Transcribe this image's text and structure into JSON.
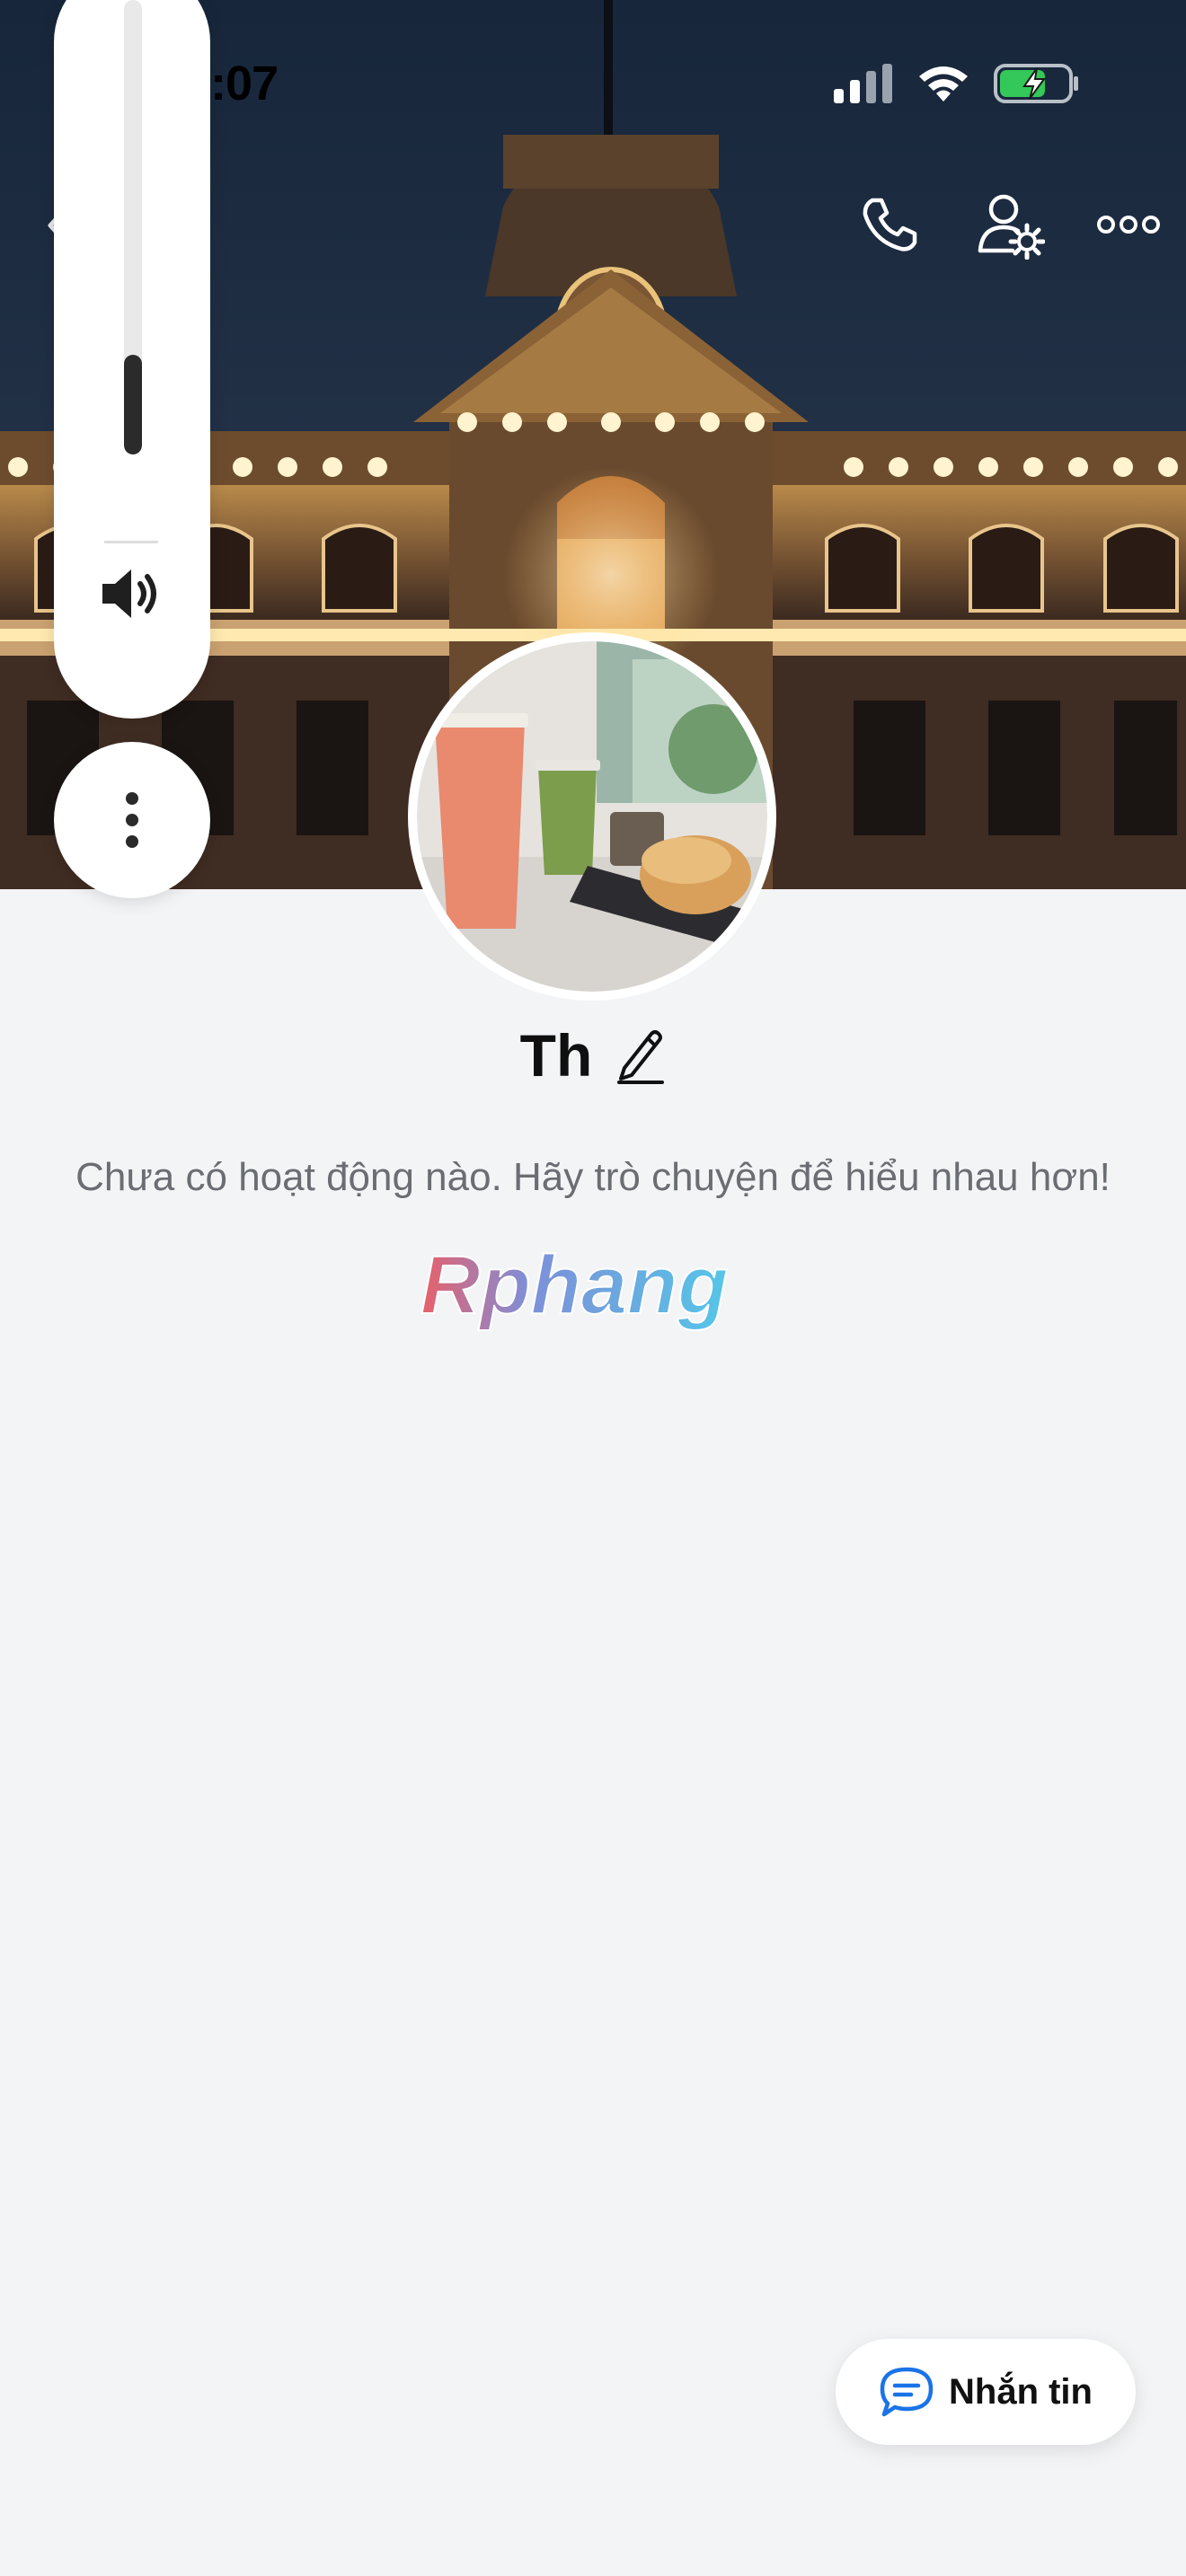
{
  "status_bar": {
    "time": "13:07",
    "icons": [
      "cellular-signal-icon",
      "wifi-icon",
      "battery-charging-icon"
    ]
  },
  "header": {
    "actions": [
      "back-icon",
      "phone-call-icon",
      "profile-settings-icon",
      "more-icon"
    ]
  },
  "volume_hud": {
    "level": 0.22,
    "icons": [
      "speaker-icon",
      "vertical-dots-icon"
    ]
  },
  "profile": {
    "name": "Th",
    "edit_icon": "pencil-icon",
    "empty_message": "Chưa có hoạt động nào. Hãy trò chuyện để hiểu nhau hơn!"
  },
  "watermark": {
    "text": "Rphang"
  },
  "message_button": {
    "label": "Nhắn tin",
    "icon": "chat-bubble-icon"
  },
  "colors": {
    "accent": "#1a73e8",
    "background": "#f3f4f6"
  }
}
